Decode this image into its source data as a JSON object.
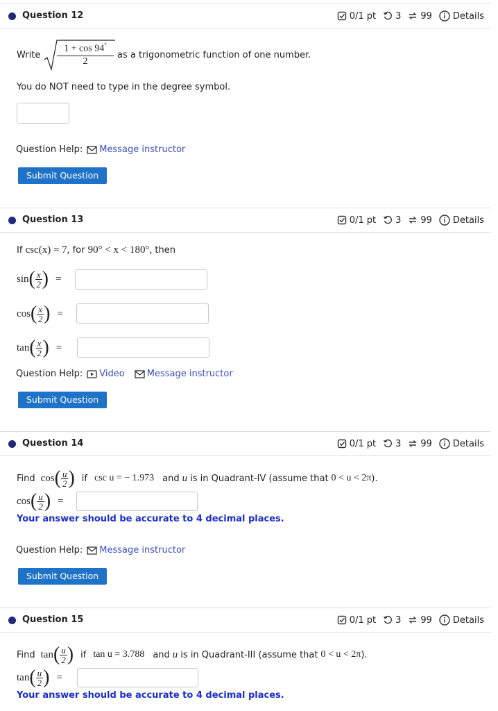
{
  "meta": {
    "points": "0/1 pt",
    "attempts": "3",
    "tries": "99",
    "details": "Details"
  },
  "q12": {
    "title": "Question 12",
    "write": "Write",
    "numerator": "1 + cos 94",
    "degree": "°",
    "denominator": "2",
    "after": "as a trigonometric function of one number.",
    "note": "You do NOT need to type in the degree symbol.",
    "answer": "",
    "help_label": "Question Help:",
    "message": "Message instructor",
    "submit": "Submit Question"
  },
  "q13": {
    "title": "Question 13",
    "if": "If",
    "cond_expr": "csc(x) = 7,",
    "for": "for",
    "range": "90° < x < 180°,",
    "then": "then",
    "rows": [
      {
        "fn": "sin",
        "num": "x",
        "den": "2",
        "eq": "=",
        "value": ""
      },
      {
        "fn": "cos",
        "num": "x",
        "den": "2",
        "eq": "=",
        "value": ""
      },
      {
        "fn": "tan",
        "num": "x",
        "den": "2",
        "eq": "=",
        "value": ""
      }
    ],
    "help_label": "Question Help:",
    "video": "Video",
    "message": "Message instructor",
    "submit": "Submit Question"
  },
  "q14": {
    "title": "Question 14",
    "find": "Find",
    "fn": "cos",
    "num": "u",
    "den": "2",
    "if": "if",
    "given": "csc u = − 1.973",
    "and": "and",
    "var": "u",
    "quad": "is in Quadrant-IV (assume that",
    "assume": "0 < u < 2π",
    "close": ").",
    "row_fn": "cos",
    "eq": "=",
    "answer": "",
    "accuracy": "Your answer should be accurate to 4 decimal places.",
    "help_label": "Question Help:",
    "message": "Message instructor",
    "submit": "Submit Question"
  },
  "q15": {
    "title": "Question 15",
    "find": "Find",
    "fn": "tan",
    "num": "u",
    "den": "2",
    "if": "if",
    "given": "tan u = 3.788",
    "and": "and",
    "var": "u",
    "quad": "is in Quadrant-III (assume that",
    "assume": "0 < u < 2π",
    "close": ").",
    "row_fn": "tan",
    "eq": "=",
    "answer": "",
    "accuracy": "Your answer should be accurate to 4 decimal places."
  },
  "colors": {
    "accent": "#1e72c8",
    "link": "#3b4fc7",
    "accuracy": "#1a2ecc",
    "dot": "#1f2a7a"
  }
}
